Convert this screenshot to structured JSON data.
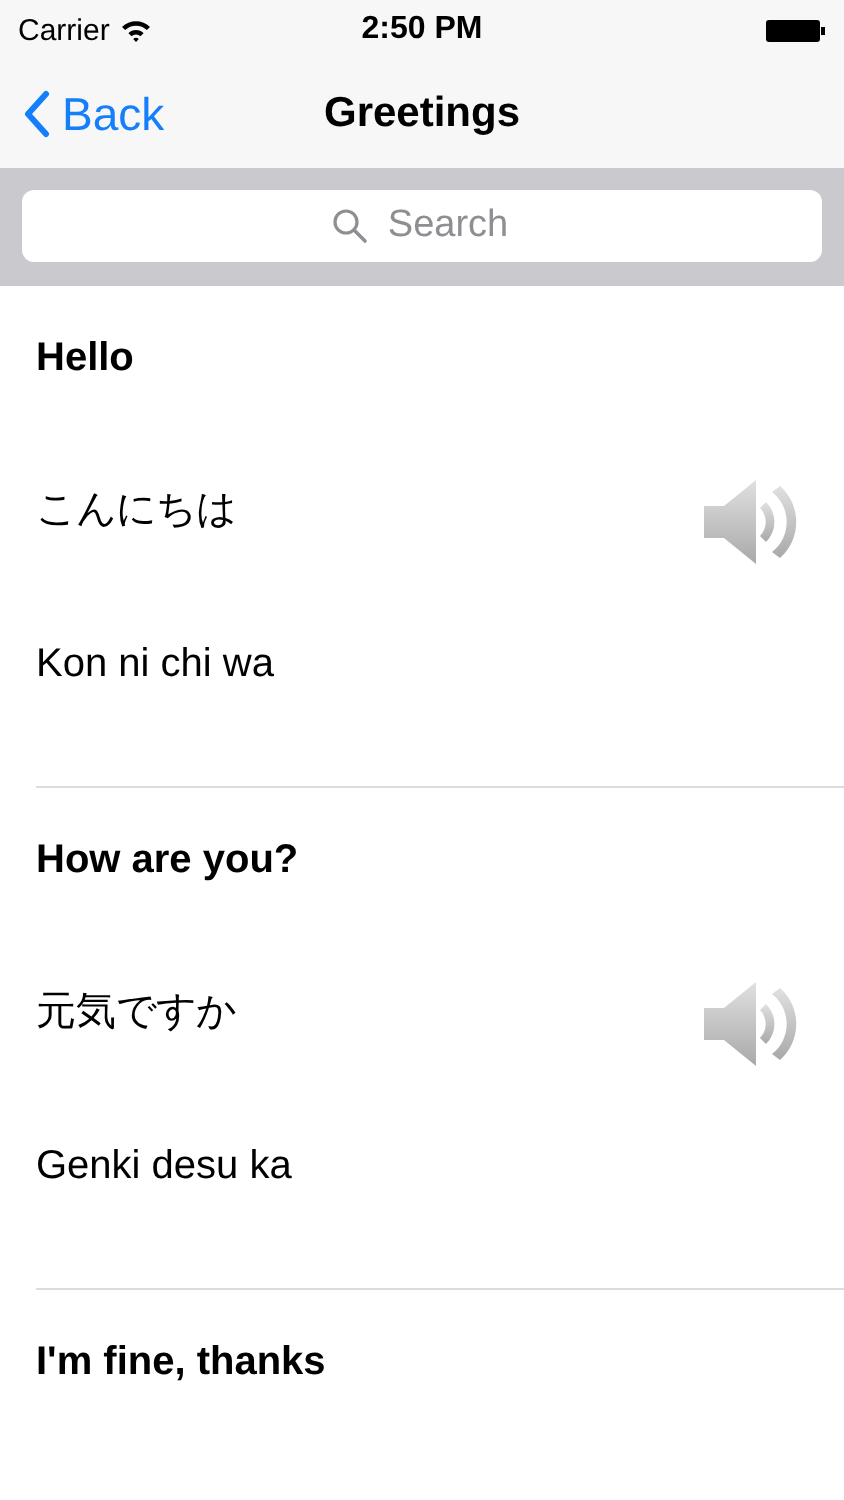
{
  "status_bar": {
    "carrier": "Carrier",
    "time": "2:50 PM"
  },
  "nav": {
    "back": "Back",
    "title": "Greetings"
  },
  "search": {
    "placeholder": "Search"
  },
  "phrases": [
    {
      "english": "Hello",
      "japanese": "こんにちは",
      "romaji": "Kon ni chi wa"
    },
    {
      "english": "How are you?",
      "japanese": "元気ですか",
      "romaji": "Genki desu ka"
    },
    {
      "english": "I'm fine, thanks"
    }
  ]
}
